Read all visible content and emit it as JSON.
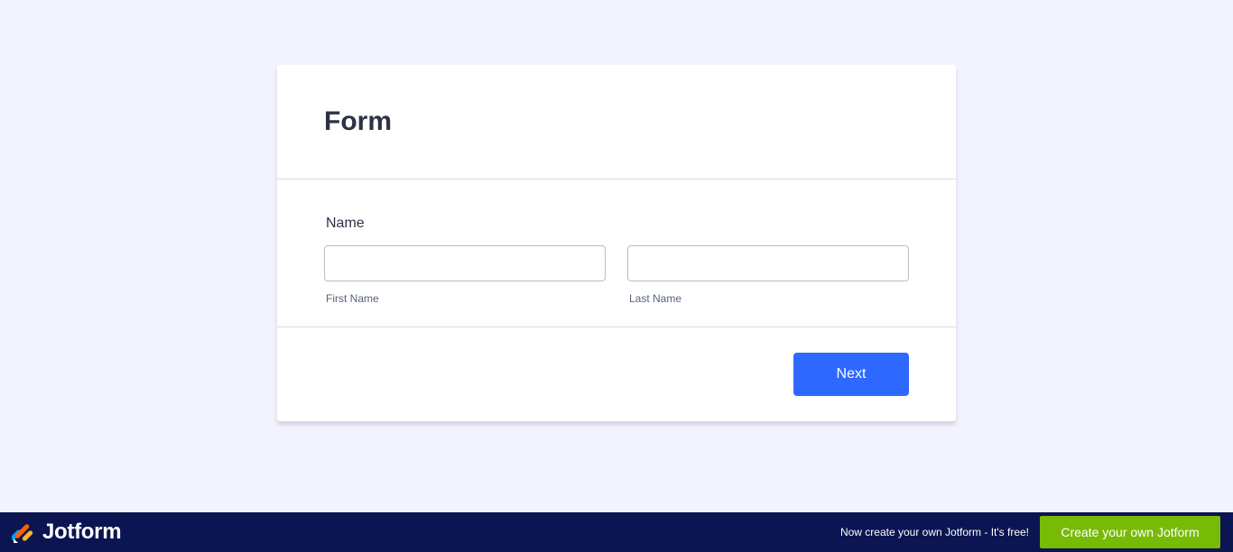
{
  "form": {
    "title": "Form",
    "name_field": {
      "label": "Name",
      "first": {
        "value": "",
        "placeholder": "",
        "sublabel": "First Name"
      },
      "last": {
        "value": "",
        "placeholder": "",
        "sublabel": "Last Name"
      }
    },
    "next_label": "Next"
  },
  "footer_bar": {
    "brand_name": "Jotform",
    "logo_icon": "jotform-logo-icon",
    "promo_text": "Now create your own Jotform - It's free!",
    "cta_label": "Create your own Jotform"
  },
  "colors": {
    "page_bg": "#f3f3fe",
    "accent": "#2e69ff",
    "bar_bg": "#0a1551",
    "cta_bg": "#78bb07"
  }
}
